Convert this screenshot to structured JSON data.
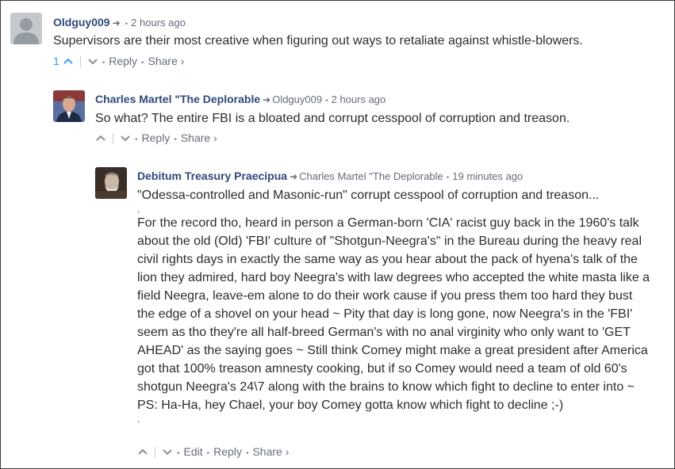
{
  "comments": [
    {
      "author": "Oldguy009",
      "reply_to": "",
      "time": "2 hours ago",
      "text": "Supervisors are their most creative when figuring out ways to retaliate against whistle-blowers.",
      "upvotes": "1",
      "actions": {
        "reply": "Reply",
        "share": "Share ›"
      }
    },
    {
      "author": "Charles Martel \"The Deplorable",
      "reply_to": "Oldguy009",
      "time": "2 hours ago",
      "text": "So what? The entire FBI is a bloated and corrupt cesspool of corruption and treason.",
      "actions": {
        "reply": "Reply",
        "share": "Share ›"
      }
    },
    {
      "author": "Debitum Treasury Praecipua",
      "reply_to": "Charles Martel \"The Deplorable",
      "time": "19 minutes ago",
      "lines": [
        "\"Odessa-controlled and Masonic-run\" corrupt cesspool of corruption and treason...",
        ".",
        "For the record tho, heard in person a German-born 'CIA' racist guy back in the 1960's talk",
        "about the old (Old) 'FBI' culture of \"Shotgun-Neegra's\" in the Bureau during the heavy real",
        "civil rights days in exactly the same way as you hear about the pack of hyena's talk of the",
        "lion they admired, hard boy Neegra's with law degrees who accepted the white masta like a",
        "field Neegra, leave-em alone to do their work cause if you press them too hard they bust",
        "the edge of a shovel on your head ~ Pity that day is long gone, now Neegra's in the 'FBI'",
        "seem as tho they're all half-breed German's with no anal virginity who only want to 'GET",
        "AHEAD' as the saying goes ~ Still think Comey might make a great president after America",
        "got that 100% treason amnesty cooking, but if so Comey would need a team of old 60's",
        "shotgun Neegra's 24\\7 along with the brains to know which fight to decline to enter into ~",
        "PS: Ha-Ha, hey Chael, your boy Comey gotta know which fight to decline ;-)",
        "."
      ],
      "actions": {
        "edit": "Edit",
        "reply": "Reply",
        "share": "Share ›"
      }
    }
  ],
  "icons": {
    "upvote": "chevron-up-icon",
    "downvote": "chevron-down-icon",
    "reply_arrow": "reply-arrow-icon"
  },
  "colors": {
    "author": "#2e4a78",
    "meta": "#656c7a",
    "upvote_active": "#2e9fff",
    "text": "#2a2e2e"
  }
}
